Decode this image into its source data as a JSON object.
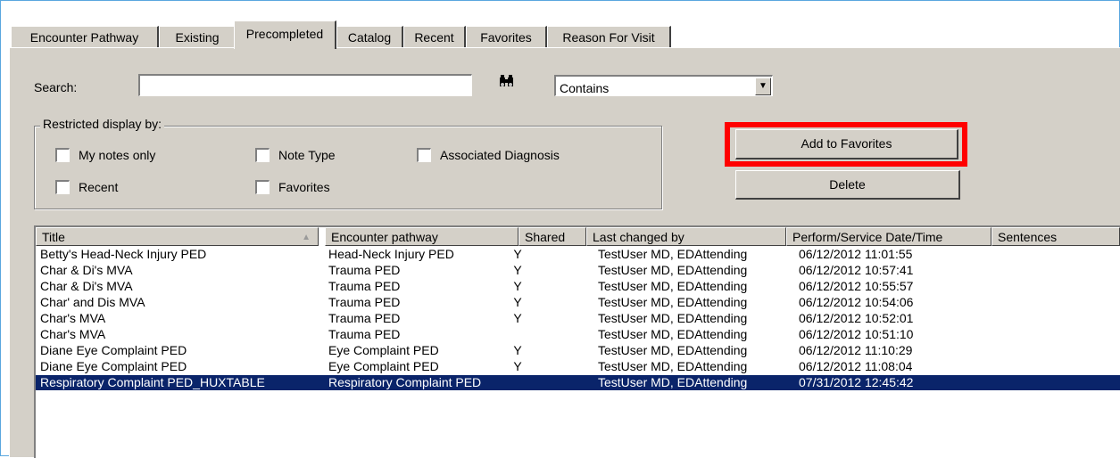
{
  "tabs": [
    "Encounter Pathway",
    "Existing",
    "Precompleted",
    "Catalog",
    "Recent",
    "Favorites",
    "Reason For Visit"
  ],
  "active_tab": "Precompleted",
  "search": {
    "label": "Search:",
    "value": "",
    "mode": "Contains",
    "binoculars_icon": "binoculars-icon"
  },
  "restrict": {
    "title": "Restricted display by:",
    "options": [
      {
        "label": "My notes only",
        "checked": false
      },
      {
        "label": "Note Type",
        "checked": false
      },
      {
        "label": "Associated Diagnosis",
        "checked": false
      },
      {
        "label": "Recent",
        "checked": false
      },
      {
        "label": "Favorites",
        "checked": false
      }
    ]
  },
  "buttons": {
    "add_favorites": "Add to Favorites",
    "delete": "Delete"
  },
  "highlight_color": "#ff0000",
  "selection_color": "#0a246a",
  "table": {
    "columns": [
      "Title",
      "Encounter pathway",
      "Shared",
      "Last changed by",
      "Perform/Service Date/Time",
      "Sentences"
    ],
    "sort_icon": "sort-ascending-icon",
    "rows": [
      [
        "Betty's Head-Neck Injury PED",
        "Head-Neck Injury PED",
        "Y",
        "TestUser MD, EDAttending",
        "06/12/2012 11:01:55",
        ""
      ],
      [
        "Char & Di's MVA",
        "Trauma PED",
        "Y",
        "TestUser MD, EDAttending",
        "06/12/2012 10:57:41",
        ""
      ],
      [
        "Char & Di's MVA",
        "Trauma PED",
        "Y",
        "TestUser MD, EDAttending",
        "06/12/2012 10:55:57",
        ""
      ],
      [
        "Char' and Dis MVA",
        "Trauma PED",
        "Y",
        "TestUser MD, EDAttending",
        "06/12/2012 10:54:06",
        ""
      ],
      [
        "Char's MVA",
        "Trauma PED",
        "Y",
        "TestUser MD, EDAttending",
        "06/12/2012 10:52:01",
        ""
      ],
      [
        "Char's MVA",
        "Trauma PED",
        "",
        "TestUser MD, EDAttending",
        "06/12/2012 10:51:10",
        ""
      ],
      [
        "Diane Eye Complaint PED",
        "Eye Complaint PED",
        "Y",
        "TestUser MD, EDAttending",
        "06/12/2012 11:10:29",
        ""
      ],
      [
        "Diane Eye Complaint PED",
        "Eye Complaint PED",
        "Y",
        "TestUser MD, EDAttending",
        "06/12/2012 11:08:04",
        ""
      ],
      [
        "Respiratory Complaint PED_HUXTABLE",
        "Respiratory Complaint PED",
        "",
        "TestUser MD, EDAttending",
        "07/31/2012 12:45:42",
        ""
      ]
    ],
    "selected_index": 8
  }
}
